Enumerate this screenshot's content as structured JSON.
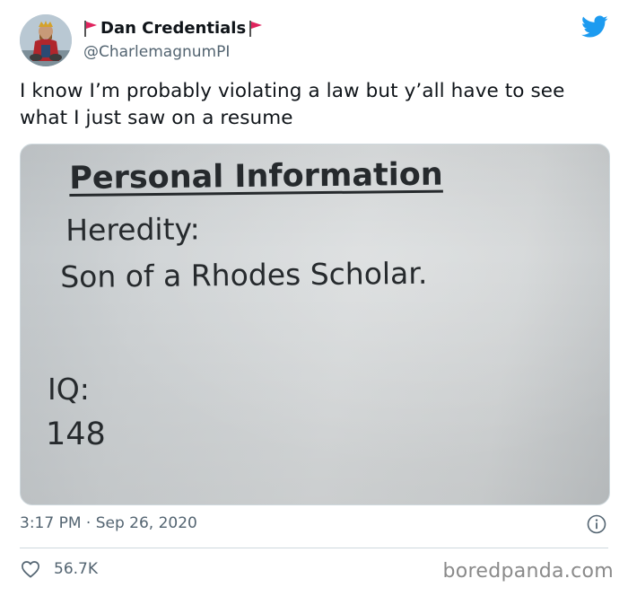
{
  "author": {
    "display_name": "Dan Credentials",
    "handle": "@CharlemagnumPI",
    "flag_color": "#e0245e"
  },
  "tweet": {
    "text": "I know I’m probably violating a law but y’all have to see what I just saw on a resume",
    "timestamp": "3:17 PM · Sep 26, 2020",
    "likes": "56.7K"
  },
  "photo": {
    "heading": "Personal Information",
    "heredity_label": "Heredity:",
    "heredity_value": "Son of a Rhodes Scholar.",
    "iq_label": "IQ:",
    "iq_value": "148"
  },
  "icons": {
    "brand": "twitter-bird-icon",
    "info": "info-icon",
    "like": "heart-icon"
  },
  "colors": {
    "twitter_blue": "#1d9bf0",
    "secondary_text": "#536471"
  },
  "watermark": "boredpanda.com"
}
